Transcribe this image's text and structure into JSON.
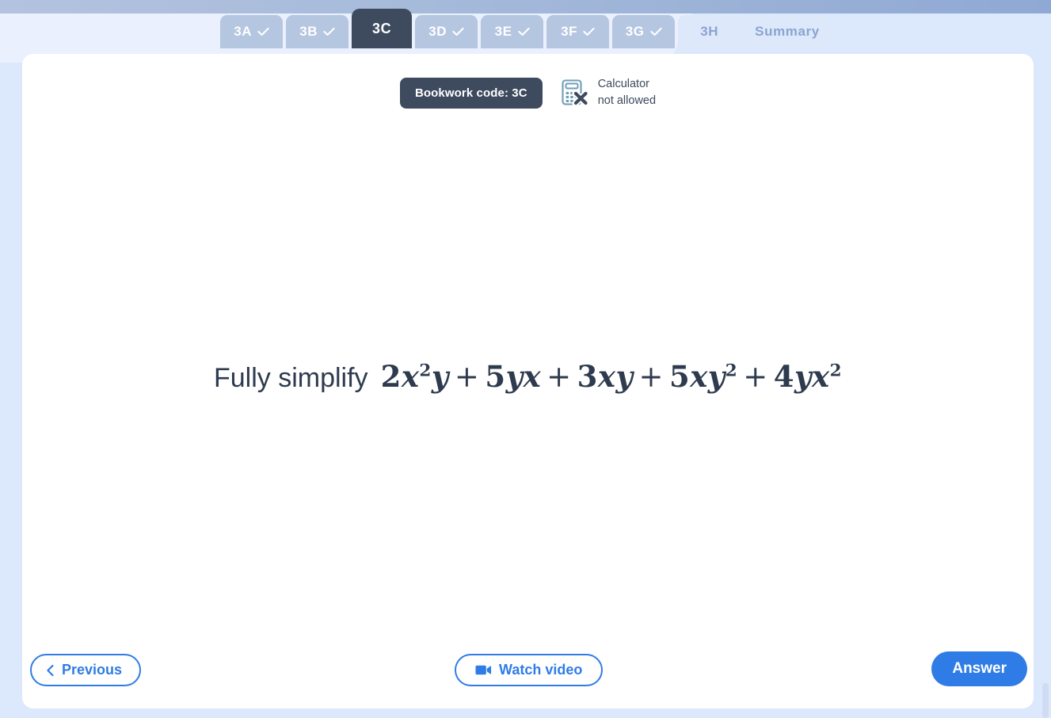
{
  "topbar": {
    "color": "#a6bada"
  },
  "tabs": [
    {
      "label": "3A",
      "state": "done",
      "tick": "check-icon"
    },
    {
      "label": "3B",
      "state": "done",
      "tick": "check-icon"
    },
    {
      "label": "3C",
      "state": "current",
      "tick": ""
    },
    {
      "label": "3D",
      "state": "done",
      "tick": "check-icon"
    },
    {
      "label": "3E",
      "state": "done",
      "tick": "check-icon"
    },
    {
      "label": "3F",
      "state": "done",
      "tick": "check-icon"
    },
    {
      "label": "3G",
      "state": "done",
      "tick": "check-icon"
    },
    {
      "label": "3H",
      "state": "upcoming",
      "tick": ""
    },
    {
      "label": "Summary",
      "state": "upcoming",
      "tick": ""
    }
  ],
  "card": {
    "bookwork_label": "Bookwork code: 3C",
    "calculator": {
      "icon": "calculator-not-allowed-icon",
      "line1": "Calculator",
      "line2": "not allowed"
    },
    "question": {
      "prompt": "Fully simplify",
      "expression_plain": "2x^2 y + 5yx + 3xy + 5xy^2 + 4yx^2",
      "terms": [
        {
          "coefficient": "2",
          "vars": [
            {
              "base": "x",
              "exp": "2"
            },
            {
              "base": "y",
              "exp": ""
            }
          ]
        },
        {
          "coefficient": "5",
          "vars": [
            {
              "base": "y",
              "exp": ""
            },
            {
              "base": "x",
              "exp": ""
            }
          ]
        },
        {
          "coefficient": "3",
          "vars": [
            {
              "base": "x",
              "exp": ""
            },
            {
              "base": "y",
              "exp": ""
            }
          ]
        },
        {
          "coefficient": "5",
          "vars": [
            {
              "base": "x",
              "exp": ""
            },
            {
              "base": "y",
              "exp": "2"
            }
          ]
        },
        {
          "coefficient": "4",
          "vars": [
            {
              "base": "y",
              "exp": ""
            },
            {
              "base": "x",
              "exp": "2"
            }
          ]
        }
      ],
      "operator": "+"
    }
  },
  "buttons": {
    "previous": {
      "label": "Previous",
      "icon": "chevron-left-icon"
    },
    "watch_video": {
      "label": "Watch video",
      "icon": "video-camera-icon"
    },
    "answer": {
      "label": "Answer"
    }
  },
  "colors": {
    "accent_blue": "#2f7ce6",
    "dark_navy": "#3e4a5e",
    "page_bg": "#eaf0fd",
    "tab_done": "#b5c6e1",
    "tab_upcoming": "#dde8fb"
  }
}
